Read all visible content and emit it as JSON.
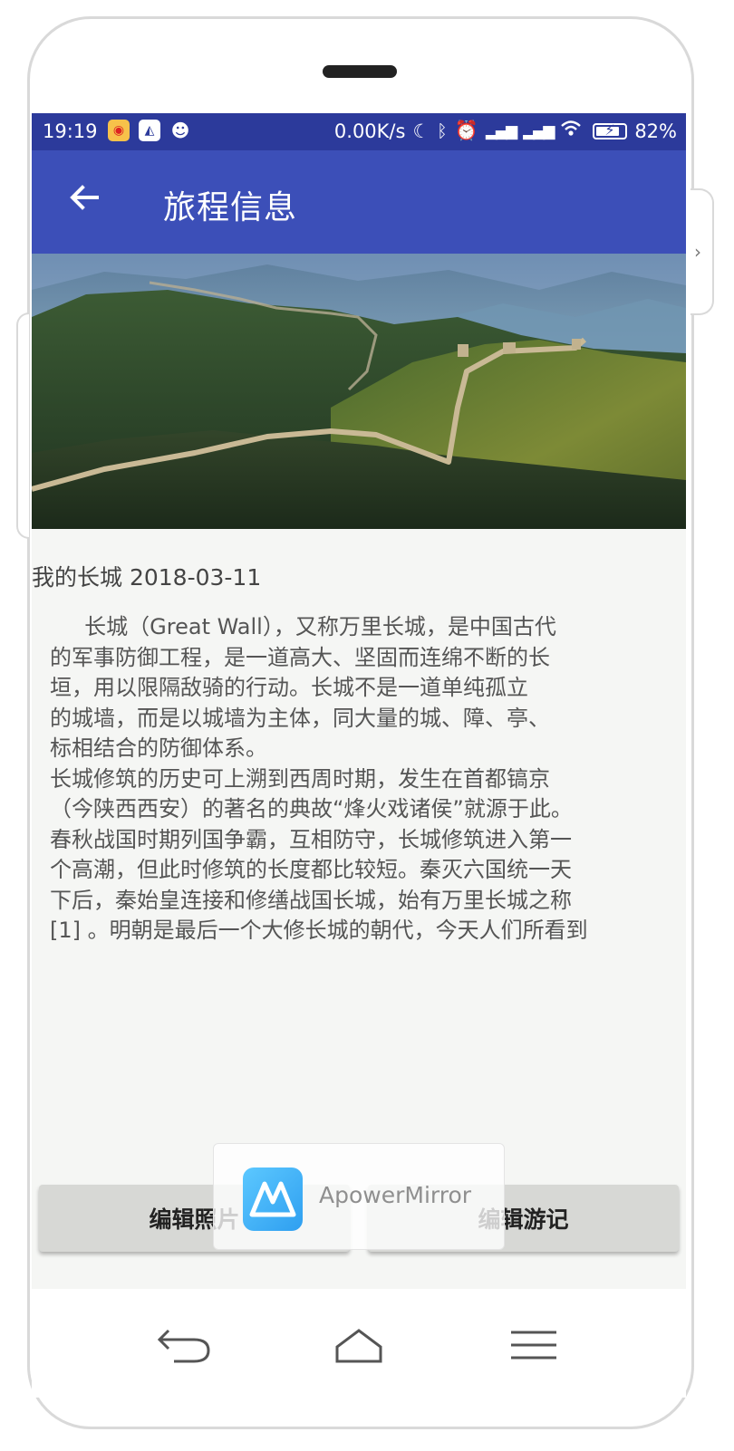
{
  "status_bar": {
    "time": "19:19",
    "network_speed": "0.00K/s",
    "battery_percent": "82%",
    "battery_level": 0.82,
    "icons_left": [
      "weibo-icon",
      "apowermirror-icon",
      "cat-icon"
    ],
    "icons_right": [
      "moon-icon",
      "bluetooth-icon",
      "alarm-icon",
      "signal-icon",
      "signal-icon",
      "wifi-icon",
      "battery-icon"
    ]
  },
  "app_bar": {
    "title": "旅程信息",
    "back_icon": "arrow-left-icon",
    "color": "#3c4fb8"
  },
  "trip": {
    "header": "我的长城 2018-03-11",
    "body": "     长城（Great Wall），又称万里长城，是中国古代\n的军事防御工程，是一道高大、坚固而连绵不断的长\n垣，用以限隔敌骑的行动。长城不是一道单纯孤立\n的城墙，而是以城墙为主体，同大量的城、障、亭、\n标相结合的防御体系。\n长城修筑的历史可上溯到西周时期，发生在首都镐京\n（今陕西西安）的著名的典故“烽火戏诸侯”就源于此。\n春秋战国时期列国争霸，互相防守，长城修筑进入第一\n个高潮，但此时修筑的长度都比较短。秦灭六国统一天\n下后，秦始皇连接和修缮战国长城，始有万里长城之称\n[1] 。明朝是最后一个大修长城的朝代，今天人们所看到"
  },
  "buttons": {
    "edit_photo": "编辑照片",
    "edit_journal": "编辑游记"
  },
  "toast": {
    "app_name": "ApowerMirror"
  },
  "nav_bar": {
    "icons": [
      "back-icon",
      "home-icon",
      "menu-icon"
    ]
  }
}
